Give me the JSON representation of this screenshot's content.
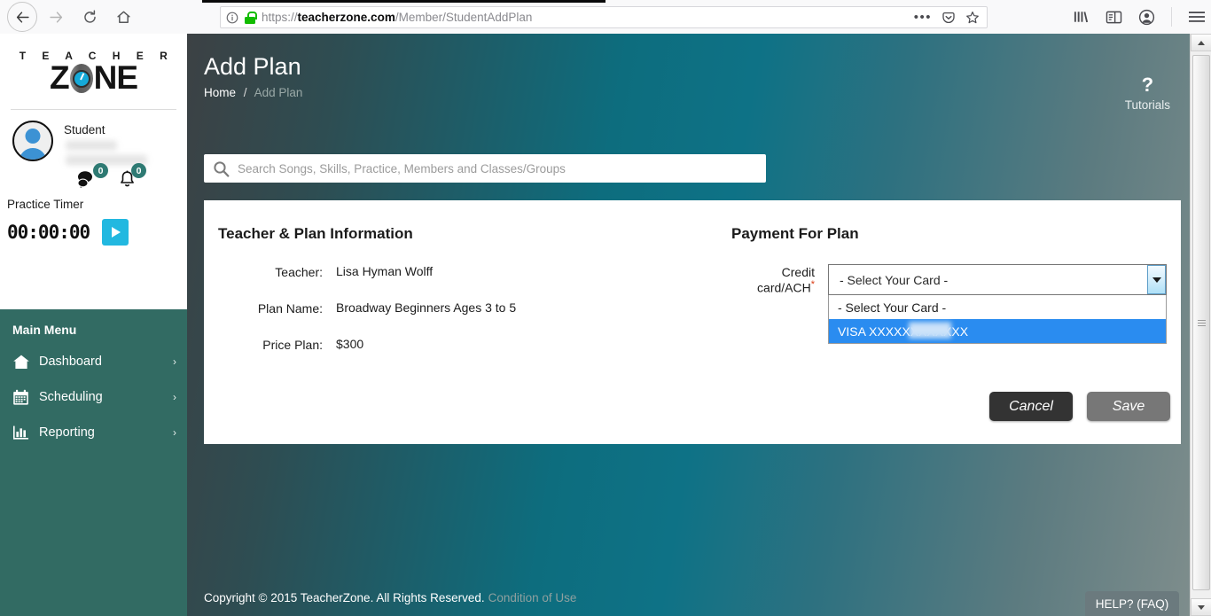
{
  "browser": {
    "url_prefix": "https://",
    "url_domain": "teacherzone.com",
    "url_path": "/Member/StudentAddPlan",
    "back_icon": "back-arrow-icon",
    "forward_icon": "forward-arrow-icon",
    "reload_icon": "reload-icon",
    "home_icon": "home-icon",
    "info_icon": "page-info-icon",
    "lock_icon": "padlock-icon",
    "more_icon": "ellipsis-icon",
    "pocket_icon": "pocket-icon",
    "bookmark_icon": "star-icon",
    "library_icon": "library-icon",
    "sidebar_icon": "sidebar-icon",
    "account_icon": "account-icon",
    "menu_icon": "hamburger-menu-icon"
  },
  "sidebar": {
    "logo": {
      "line1": "T E A C H E R",
      "z": "Z",
      "ne": "NE"
    },
    "profile": {
      "role": "Student",
      "name_redacted": true
    },
    "badges": [
      {
        "icon": "chat-icon",
        "count": "0"
      },
      {
        "icon": "bell-icon",
        "count": "0"
      }
    ],
    "practice_timer": {
      "label": "Practice Timer",
      "value": "00:00:00",
      "play_icon": "play-icon"
    },
    "menu_title": "Main Menu",
    "menu_items": [
      {
        "label": "Dashboard",
        "icon": "home-icon",
        "chevron": "›"
      },
      {
        "label": "Scheduling",
        "icon": "calendar-icon",
        "chevron": "›"
      },
      {
        "label": "Reporting",
        "icon": "bar-chart-icon",
        "chevron": "›"
      }
    ]
  },
  "header": {
    "title": "Add Plan",
    "breadcrumb_home": "Home",
    "breadcrumb_sep": "/",
    "breadcrumb_current": "Add Plan",
    "tutorials_icon": "?",
    "tutorials_label": "Tutorials"
  },
  "search": {
    "placeholder": "Search Songs, Skills, Practice, Members and Classes/Groups",
    "value": "",
    "icon": "search-icon"
  },
  "form": {
    "left_title": "Teacher & Plan Information",
    "fields": [
      {
        "label": "Teacher:",
        "value": "Lisa Hyman Wolff"
      },
      {
        "label": "Plan Name:",
        "value": "Broadway Beginners Ages 3 to 5"
      },
      {
        "label": "Price Plan:",
        "value": "$300"
      }
    ],
    "right_title": "Payment For Plan",
    "card_label": "Credit card/ACH",
    "card_required_mark": "*",
    "card_selected": "- Select Your Card -",
    "card_options": [
      {
        "label": "- Select Your Card -",
        "selected": false
      },
      {
        "label": "VISA XXXXXXXXXXXX",
        "selected": true,
        "masked_tail": true
      }
    ],
    "cancel_label": "Cancel",
    "save_label": "Save"
  },
  "footer": {
    "copyright": "Copyright © 2015 TeacherZone. All Rights Reserved.",
    "link": "Condition of Use",
    "help_label": "HELP? (FAQ)"
  },
  "colors": {
    "sidebar_menu": "#326b63",
    "accent_teal": "#0e7286",
    "play_button": "#22b8e0",
    "badge": "#2e7a73",
    "dropdown_highlight": "#2a8cf0",
    "required": "#d93a13"
  }
}
